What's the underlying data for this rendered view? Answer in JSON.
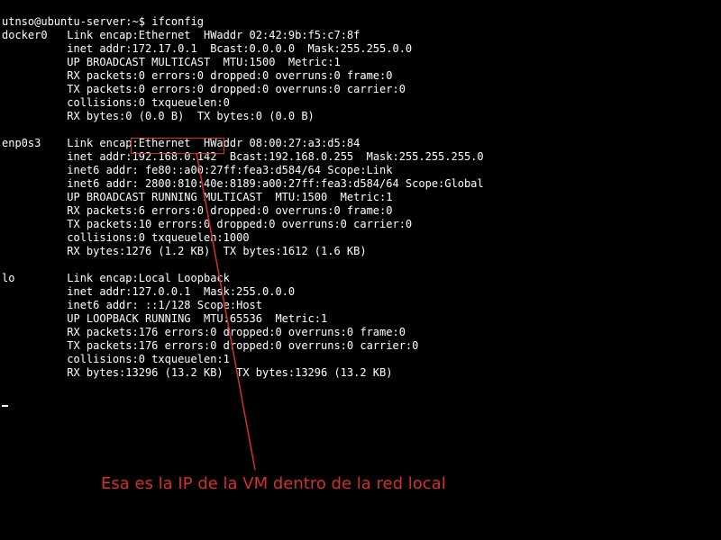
{
  "prompt": {
    "userhost": "utnso@ubuntu-server",
    "path": "~",
    "symbol": "$",
    "command": "ifconfig"
  },
  "interfaces": {
    "docker0": {
      "name": "docker0",
      "l1": "Link encap:Ethernet  HWaddr 02:42:9b:f5:c7:8f",
      "l2": "inet addr:172.17.0.1  Bcast:0.0.0.0  Mask:255.255.0.0",
      "l3": "UP BROADCAST MULTICAST  MTU:1500  Metric:1",
      "l4": "RX packets:0 errors:0 dropped:0 overruns:0 frame:0",
      "l5": "TX packets:0 errors:0 dropped:0 overruns:0 carrier:0",
      "l6": "collisions:0 txqueuelen:0",
      "l7": "RX bytes:0 (0.0 B)  TX bytes:0 (0.0 B)"
    },
    "enp0s3": {
      "name": "enp0s3",
      "l1": "Link encap:Ethernet  HWaddr 08:00:27:a3:d5:84",
      "l2a": "inet addr:",
      "l2_ip": "192.168.0.142",
      "l2b": "  Bcast:192.168.0.255  Mask:255.255.255.0",
      "l3": "inet6 addr: fe80::a00:27ff:fea3:d584/64 Scope:Link",
      "l4": "inet6 addr: 2800:810:40e:8189:a00:27ff:fea3:d584/64 Scope:Global",
      "l5": "UP BROADCAST RUNNING MULTICAST  MTU:1500  Metric:1",
      "l6": "RX packets:6 errors:0 dropped:0 overruns:0 frame:0",
      "l7": "TX packets:10 errors:0 dropped:0 overruns:0 carrier:0",
      "l8": "collisions:0 txqueuelen:1000",
      "l9": "RX bytes:1276 (1.2 KB)  TX bytes:1612 (1.6 KB)"
    },
    "lo": {
      "name": "lo",
      "l1": "Link encap:Local Loopback",
      "l2": "inet addr:127.0.0.1  Mask:255.0.0.0",
      "l3": "inet6 addr: ::1/128 Scope:Host",
      "l4": "UP LOOPBACK RUNNING  MTU:65536  Metric:1",
      "l5": "RX packets:176 errors:0 dropped:0 overruns:0 frame:0",
      "l6": "TX packets:176 errors:0 dropped:0 overruns:0 carrier:0",
      "l7": "collisions:0 txqueuelen:1",
      "l8": "RX bytes:13296 (13.2 KB)  TX bytes:13296 (13.2 KB)"
    }
  },
  "annotation": {
    "text": "Esa es la IP de la VM dentro de la red local"
  },
  "colors": {
    "annotation": "#d32f2f"
  }
}
